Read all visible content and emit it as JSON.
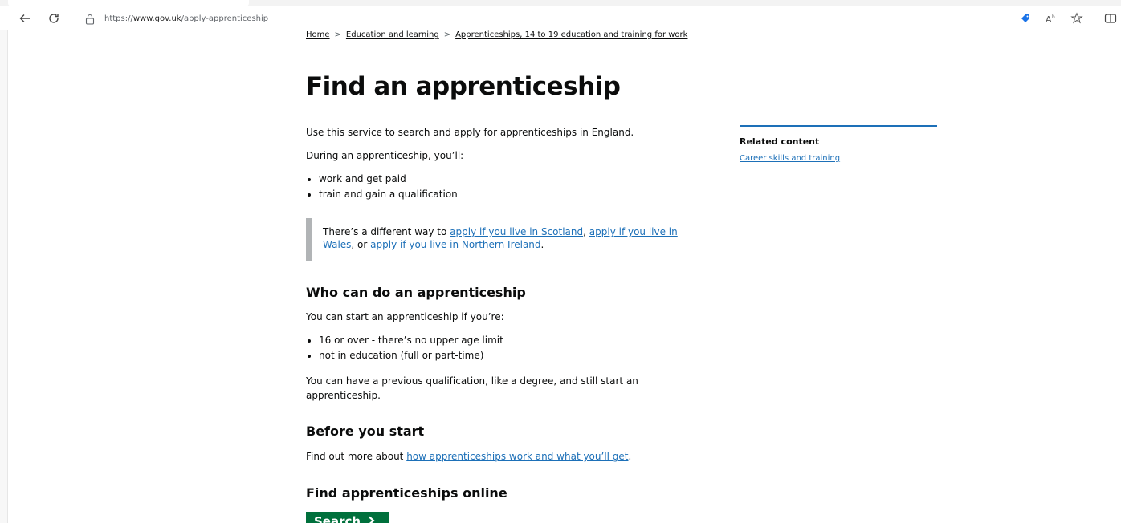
{
  "browser": {
    "url_prefix": "https://",
    "url_domain": "www.gov.uk",
    "url_path": "/apply-apprenticeship"
  },
  "breadcrumb": [
    {
      "label": "Home"
    },
    {
      "label": "Education and learning"
    },
    {
      "label": "Apprenticeships, 14 to 19 education and training for work"
    }
  ],
  "breadcrumb_separator": ">",
  "page": {
    "title": "Find an apprenticeship",
    "intro": "Use this service to search and apply for apprenticeships in England.",
    "during_lead": "During an apprenticeship, you’ll:",
    "during_items": [
      "work and get paid",
      "train and gain a qualification"
    ],
    "inset": {
      "prefix": "There’s a different way to ",
      "link1": "apply if you live in Scotland",
      "sep1": ", ",
      "link2a": "apply if you live in",
      "link2b": "Wales",
      "sep2": ", or ",
      "link3": "apply if you live in Northern Ireland",
      "suffix": "."
    },
    "who_heading": "Who can do an apprenticeship",
    "who_lead": "You can start an apprenticeship if you’re:",
    "who_items": [
      "16 or over - there’s no upper age limit",
      "not in education (full or part-time)"
    ],
    "who_note_line1": "You can have a previous qualification, like a degree, and still start an",
    "who_note_line2": "apprenticeship.",
    "before_heading": "Before you start",
    "before_prefix": "Find out more about ",
    "before_link": "how apprenticeships work and what you’ll get",
    "before_suffix": ".",
    "online_heading": "Find apprenticeships online",
    "search_button": "Search"
  },
  "related": {
    "heading": "Related content",
    "links": [
      "Career skills and training"
    ]
  },
  "colors": {
    "link": "#1d70b8",
    "button": "#00703c",
    "text": "#0b0c0c"
  }
}
